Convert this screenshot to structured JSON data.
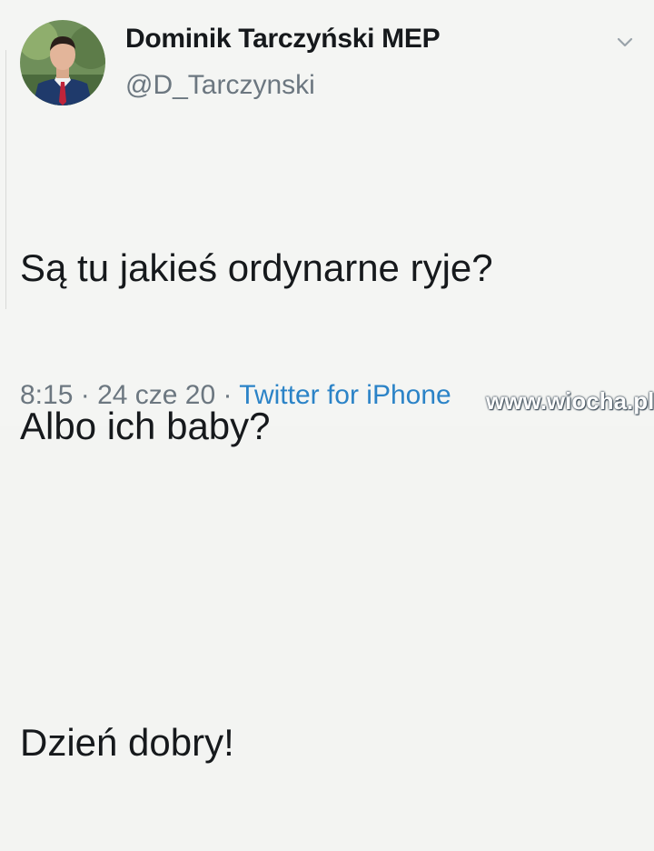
{
  "tweet": {
    "author": {
      "display_name": "Dominik Tarczyński MEP",
      "handle": "@D_Tarczynski",
      "avatar_icon": "profile-photo"
    },
    "menu_icon": "chevron-down-icon",
    "body_lines": [
      "Są tu jakieś ordynarne ryje?",
      "Albo ich baby?",
      "",
      "Dzień dobry!"
    ],
    "footer": {
      "time": "8:15",
      "separator1": " · ",
      "date": "24 cze 20",
      "separator2": " · ",
      "source": "Twitter for iPhone"
    }
  },
  "watermark": "www.wiocha.pl",
  "colors": {
    "background": "#f4f5f3",
    "text": "#16191c",
    "secondary": "#6c7780",
    "link": "#2b83c7"
  }
}
